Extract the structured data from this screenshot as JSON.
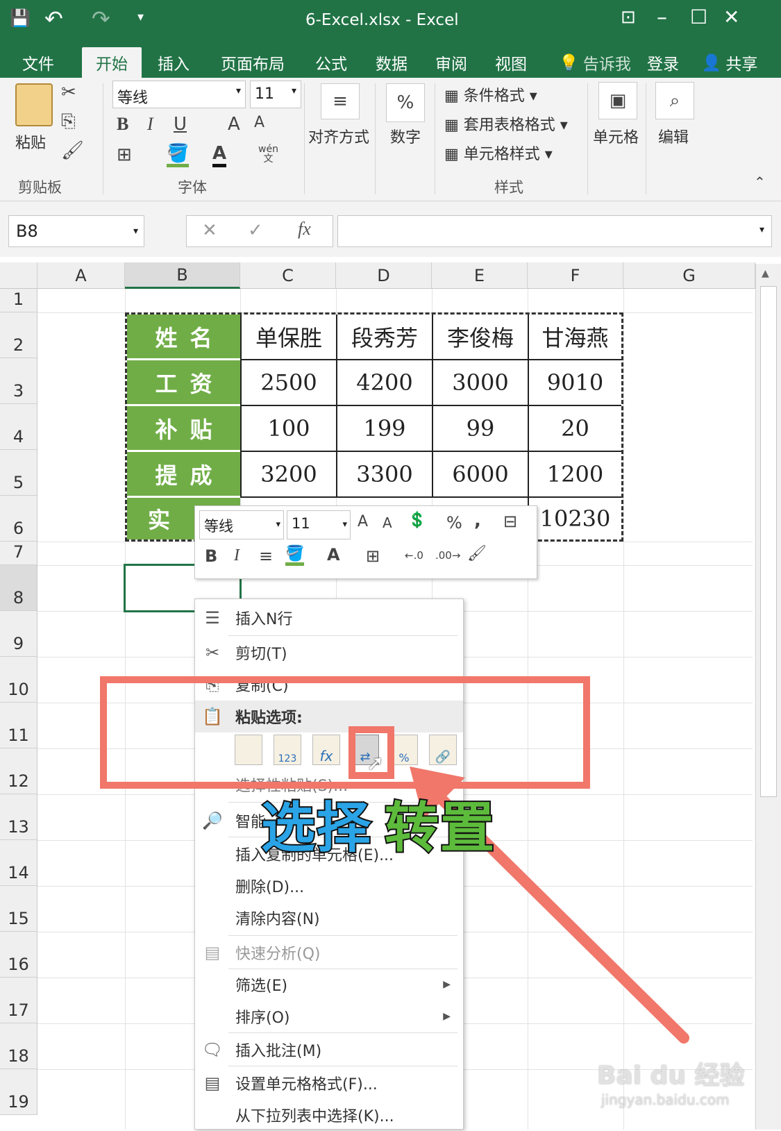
{
  "window": {
    "title": "6-Excel.xlsx - Excel",
    "min": "–",
    "max": "☐",
    "close": "✕",
    "ribbon_opt": "⊡"
  },
  "qat": {
    "save": "💾",
    "undo": "↶",
    "redo": "↷",
    "more": "▾"
  },
  "tabs": [
    "文件",
    "开始",
    "插入",
    "页面布局",
    "公式",
    "数据",
    "审阅",
    "视图"
  ],
  "tell_me": "告诉我",
  "signin": "登录",
  "share": "共享",
  "ribbon": {
    "paste": "粘贴",
    "clipboard": "剪贴板",
    "font": "字体",
    "font_name": "等线",
    "font_size": "11",
    "align": "对齐方式",
    "number": "数字",
    "percent": "%",
    "cond_format": "条件格式",
    "table_format": "套用表格格式",
    "cell_style": "单元格样式",
    "styles": "样式",
    "cells": "单元格",
    "edit": "编辑",
    "wen": "wén\n文"
  },
  "formula_bar": {
    "name_box": "B8",
    "fx": "fx",
    "value": ""
  },
  "columns": [
    "A",
    "B",
    "C",
    "D",
    "E",
    "F",
    "G"
  ],
  "rows": [
    "1",
    "2",
    "3",
    "4",
    "5",
    "6",
    "7",
    "8",
    "9",
    "10",
    "11",
    "12",
    "13",
    "14",
    "15",
    "16",
    "17",
    "18",
    "19"
  ],
  "table": {
    "headers": [
      "姓名",
      "工资",
      "补贴",
      "提成",
      "实"
    ],
    "names": [
      "单保胜",
      "段秀芳",
      "李俊梅",
      "甘海燕"
    ],
    "salary": [
      "2500",
      "4200",
      "3000",
      "9010"
    ],
    "allowance": [
      "100",
      "199",
      "99",
      "20"
    ],
    "commission": [
      "3200",
      "3300",
      "6000",
      "1200"
    ],
    "actual_f": "10230"
  },
  "mini_toolbar": {
    "font": "等线",
    "size": "11",
    "percent": "%",
    "comma": ","
  },
  "context_menu": {
    "insert_rows": "插入N行",
    "cut": "剪切(T)",
    "copy": "复制(C)",
    "paste_options": "粘贴选项:",
    "paste_special": "选择性粘贴(S)...",
    "smart": "智能",
    "insert_copied": "插入复制的单元格(E)...",
    "delete": "删除(D)...",
    "clear": "清除内容(N)",
    "quick": "快速分析(Q)",
    "filter": "筛选(E)",
    "sort": "排序(O)",
    "comment": "插入批注(M)",
    "format": "设置单元格格式(F)...",
    "dropdown": "从下拉列表中选择(K)..."
  },
  "annotation": {
    "part1": "选择",
    "part2": "转置"
  },
  "watermark": {
    "logo": "Bai du 经验",
    "url": "jingyan.baidu.com"
  },
  "colors": {
    "excel_green": "#217346",
    "header_fill": "#70ad47",
    "highlight": "#f0776a"
  }
}
